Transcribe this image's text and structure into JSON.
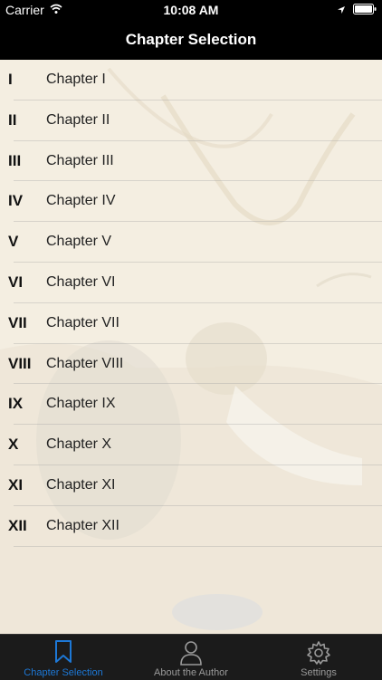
{
  "status_bar": {
    "carrier": "Carrier",
    "time": "10:08 AM"
  },
  "nav": {
    "title": "Chapter Selection"
  },
  "chapters": [
    {
      "num": "I",
      "label": "Chapter I"
    },
    {
      "num": "II",
      "label": "Chapter II"
    },
    {
      "num": "III",
      "label": "Chapter III"
    },
    {
      "num": "IV",
      "label": "Chapter IV"
    },
    {
      "num": "V",
      "label": "Chapter V"
    },
    {
      "num": "VI",
      "label": "Chapter VI"
    },
    {
      "num": "VII",
      "label": "Chapter VII"
    },
    {
      "num": "VIII",
      "label": "Chapter VIII"
    },
    {
      "num": "IX",
      "label": "Chapter IX"
    },
    {
      "num": "X",
      "label": "Chapter X"
    },
    {
      "num": "XI",
      "label": "Chapter XI"
    },
    {
      "num": "XII",
      "label": "Chapter XII"
    }
  ],
  "tab_bar": {
    "tabs": [
      {
        "label": "Chapter Selection",
        "icon": "bookmark-icon",
        "active": true
      },
      {
        "label": "About the Author",
        "icon": "person-icon",
        "active": false
      },
      {
        "label": "Settings",
        "icon": "gear-icon",
        "active": false
      }
    ]
  },
  "colors": {
    "accent": "#1d78d6",
    "bar_bg": "#000000",
    "tab_bg": "#1b1b1b"
  }
}
